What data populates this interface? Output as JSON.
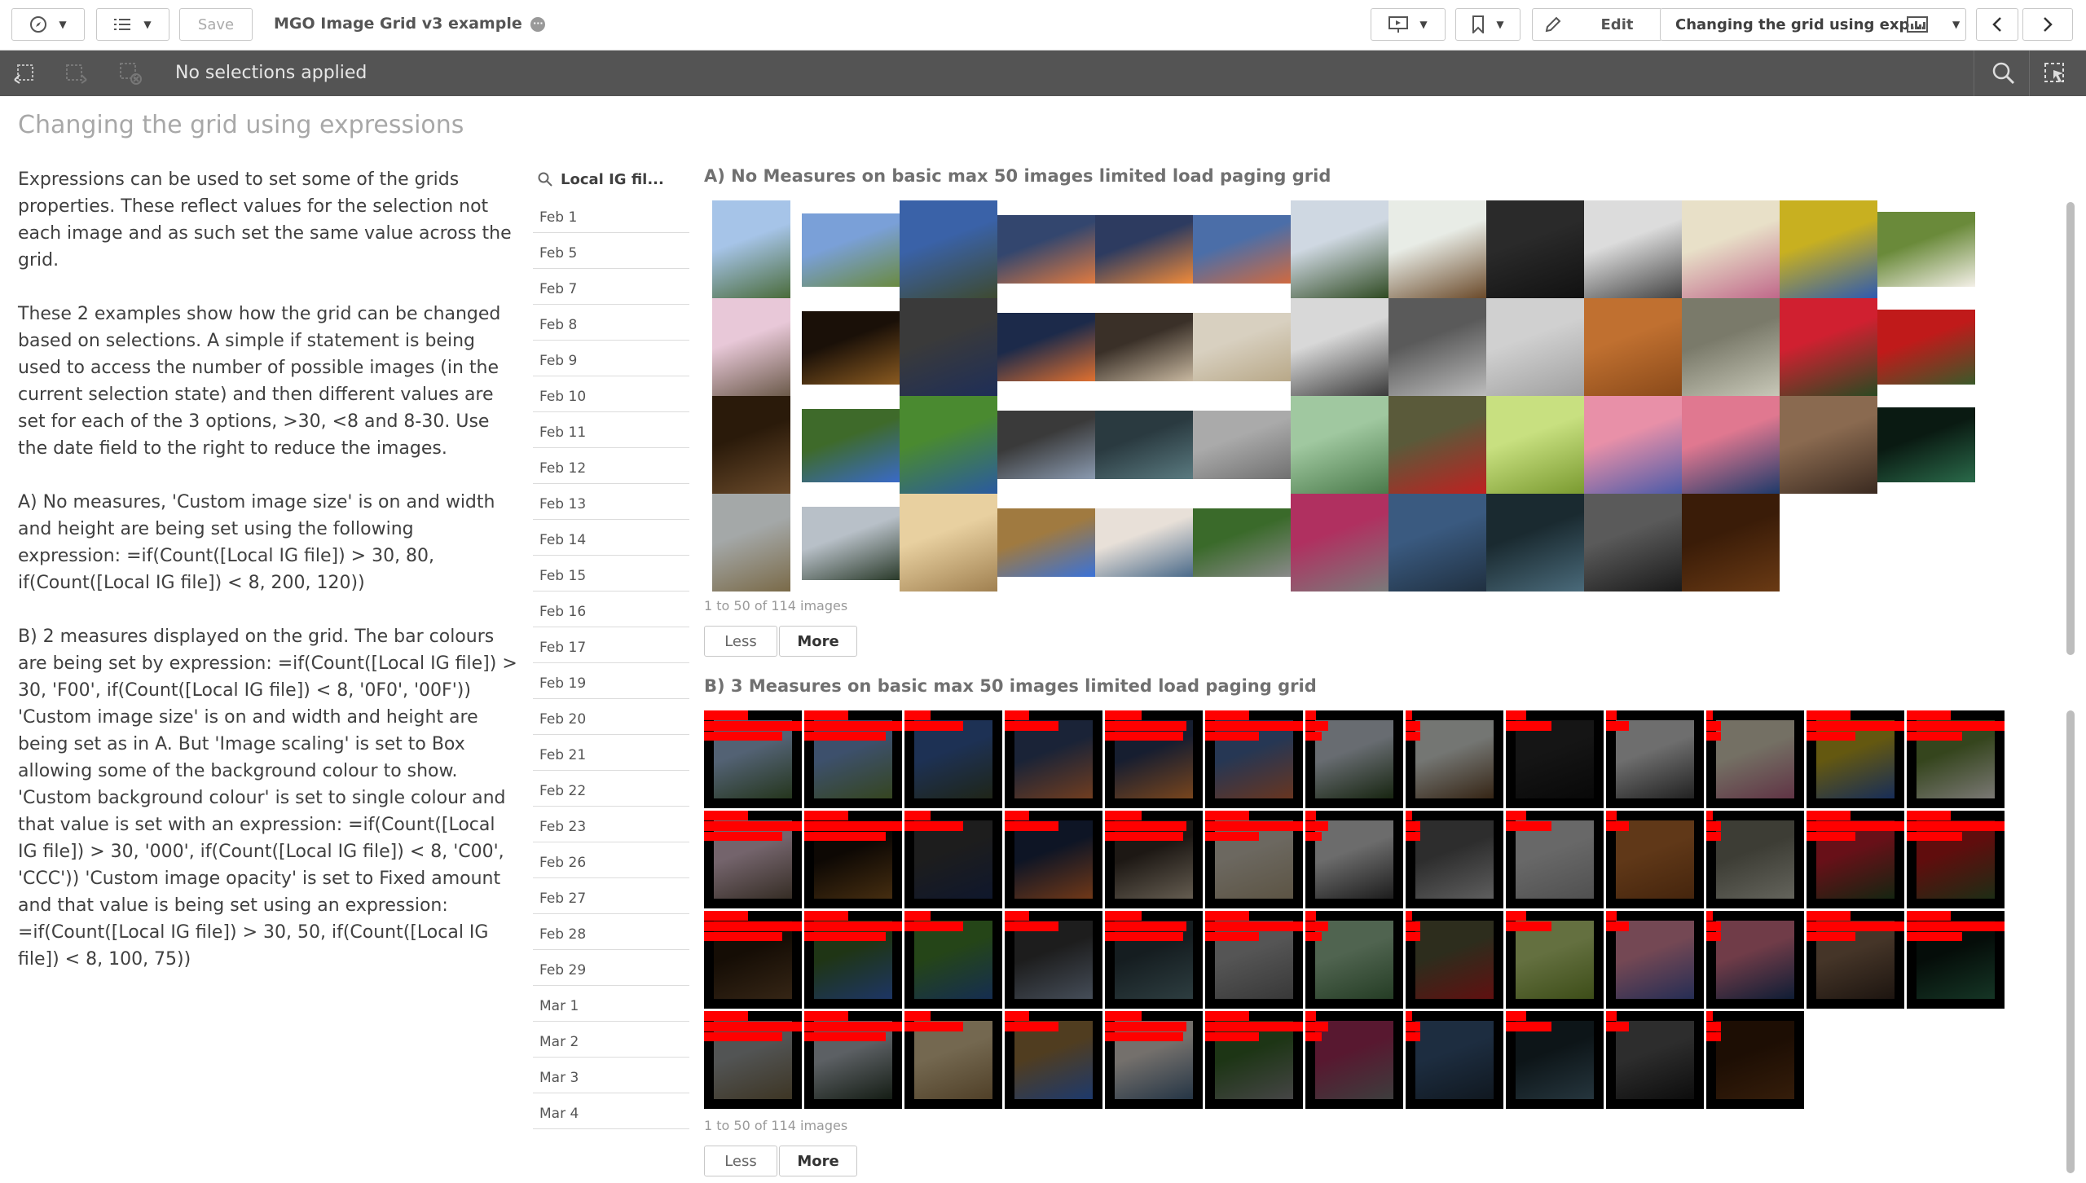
{
  "toolbar": {
    "app_title": "MGO Image Grid v3 example",
    "save_label": "Save",
    "edit_label": "Edit",
    "sheet_selector": "Changing the grid using exp..."
  },
  "selections": {
    "status": "No selections applied"
  },
  "sheet": {
    "title": "Changing the grid using expressions"
  },
  "description": [
    "Expressions can be used to set some of the grids properties. These reflect values for the selection not each image and as such set the same value across the grid.",
    "These 2 examples show how the grid can be changed based on selections. A simple if statement is being used to access the number of possible images (in the current selection state) and then different values are set for each of the 3 options, >30, <8 and 8-30. Use the date field to the right to reduce the images.",
    "A) No measures, 'Custom image size' is on and width and height are being set using the following expression: =if(Count([Local IG file]) > 30, 80, if(Count([Local IG file]) < 8, 200, 120))",
    "B) 2 measures displayed on the grid. The bar colours are being set by expression: =if(Count([Local IG file]) > 30, 'F00', if(Count([Local IG file]) < 8, '0F0', '00F')) 'Custom image size' is on and width and height are being set as in A. But 'Image scaling' is set to Box allowing some of the background colour to show. 'Custom background colour' is set to single colour and that value is set with an expression: =if(Count([Local IG file]) > 30, '000', if(Count([Local IG file]) < 8, 'C00', 'CCC')) 'Custom image opacity' is set to Fixed amount and that value is being set using an expression: =if(Count([Local IG file]) > 30, 50, if(Count([Local IG file]) < 8, 100, 75))"
  ],
  "filter": {
    "title": "Local IG fil...",
    "items": [
      "Feb 1",
      "Feb 5",
      "Feb 7",
      "Feb 8",
      "Feb 9",
      "Feb 10",
      "Feb 11",
      "Feb 12",
      "Feb 13",
      "Feb 14",
      "Feb 15",
      "Feb 16",
      "Feb 17",
      "Feb 19",
      "Feb 20",
      "Feb 21",
      "Feb 22",
      "Feb 23",
      "Feb 26",
      "Feb 27",
      "Feb 28",
      "Feb 29",
      "Mar 1",
      "Mar 2",
      "Mar 3",
      "Mar 4"
    ]
  },
  "gridA": {
    "title": "A) No Measures on basic max 50 images limited load paging grid",
    "paging_text": "1 to 50 of 114 images",
    "less_label": "Less",
    "more_label": "More"
  },
  "gridB": {
    "title": "B) 3 Measures on basic max 50 images limited load paging grid",
    "paging_text": "1 to 50 of 114 images",
    "less_label": "Less",
    "more_label": "More",
    "bar_color": "#ff0000",
    "background_color": "#000000"
  },
  "image_palette": [
    [
      "#4a6b3a",
      "#a6c4e8"
    ],
    [
      "#6a8a40",
      "#7aa0d8"
    ],
    [
      "#3e4a30",
      "#3a62a8"
    ],
    [
      "#e07a40",
      "#33466e"
    ],
    [
      "#f08a3a",
      "#2d3b60"
    ],
    [
      "#d06a40",
      "#4b6ea8"
    ],
    [
      "#2f4a22",
      "#cfd8e2"
    ],
    [
      "#6b4a2a",
      "#e8ece6"
    ],
    [
      "#111111",
      "#2a2a2a"
    ],
    [
      "#444444",
      "#dcdcdc"
    ],
    [
      "#c0688a",
      "#e8e0c8"
    ],
    [
      "#2e5ab0",
      "#c8b020"
    ],
    [
      "#f4f0e8",
      "#6a8a3a"
    ],
    [
      "#6b5a4a",
      "#e8c8d8"
    ],
    [
      "#8a5a20",
      "#1a1008"
    ],
    [
      "#1e2e58",
      "#3a3a3a"
    ],
    [
      "#e07030",
      "#1c2a4a"
    ],
    [
      "#c8b8a0",
      "#3a3028"
    ],
    [
      "#b8a888",
      "#d8d0c0"
    ],
    [
      "#3a3a3a",
      "#d8d8d8"
    ],
    [
      "#bcbcbc",
      "#5a5a5a"
    ],
    [
      "#a0a0a0",
      "#d0d0d0"
    ],
    [
      "#8a4a1a",
      "#c07030"
    ],
    [
      "#c8c8b8",
      "#7a7a6a"
    ],
    [
      "#2a4a22",
      "#d02030"
    ],
    [
      "#3a5a2a",
      "#c01a1a"
    ],
    [
      "#6a4a2a",
      "#2a1a0a"
    ],
    [
      "#3a6ac8",
      "#3e6a2a"
    ],
    [
      "#2a5aa0",
      "#4a8a30"
    ],
    [
      "#8a9ab0",
      "#3a3a3a"
    ],
    [
      "#5a7a80",
      "#2a3a40"
    ],
    [
      "#707070",
      "#aaaaaa"
    ],
    [
      "#4a7a4a",
      "#a0c8a0"
    ],
    [
      "#c02020",
      "#5a5a3a"
    ],
    [
      "#7a9a30",
      "#c8e080"
    ],
    [
      "#4a5aa8",
      "#e890a8"
    ],
    [
      "#1e3a6a",
      "#e07890"
    ],
    [
      "#3a2a20",
      "#8a6a50"
    ],
    [
      "#2a6a4a",
      "#0a1a12"
    ],
    [
      "#7a6a48",
      "#a4a8a8"
    ],
    [
      "#2a3a2a",
      "#b8c0c8"
    ],
    [
      "#a08050",
      "#e8d0a0"
    ],
    [
      "#3a72d8",
      "#a07a40"
    ],
    [
      "#4a6a8a",
      "#e8e0d8"
    ],
    [
      "#8a8a8a",
      "#3a6a2a"
    ],
    [
      "#7a7a7a",
      "#b03060"
    ],
    [
      "#203040",
      "#3a5a80"
    ],
    [
      "#4a6a7a",
      "#1a2a30"
    ],
    [
      "#1a1a1a",
      "#5a5a5a"
    ],
    [
      "#6a3a14",
      "#3a1c08"
    ]
  ]
}
